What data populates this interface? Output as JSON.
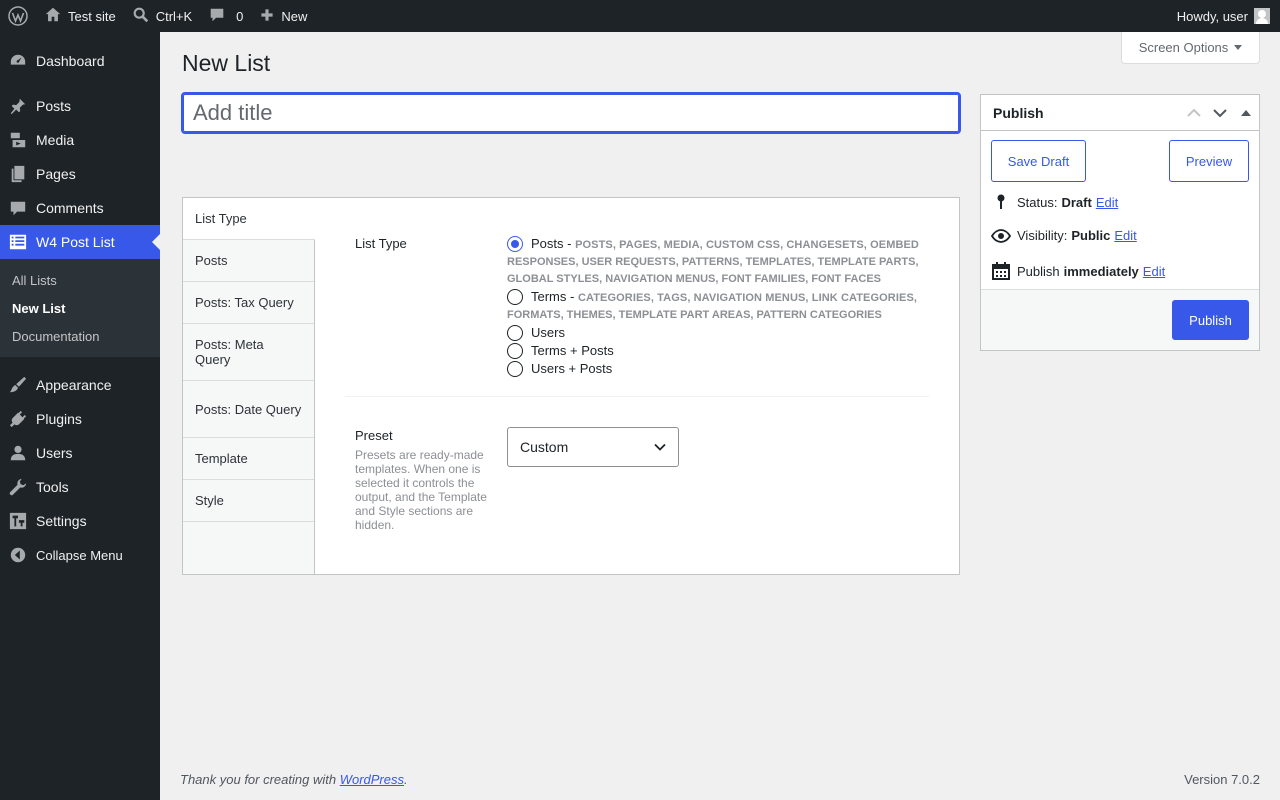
{
  "admin_bar": {
    "site_name": "Test site",
    "search_shortcut": "Ctrl+K",
    "comments_count": "0",
    "new_label": "New",
    "greeting": "Howdy, user"
  },
  "sidebar": {
    "items": [
      {
        "label": "Dashboard",
        "icon": "dashboard-icon"
      },
      {
        "label": "Posts",
        "icon": "pin-icon"
      },
      {
        "label": "Media",
        "icon": "media-icon"
      },
      {
        "label": "Pages",
        "icon": "pages-icon"
      },
      {
        "label": "Comments",
        "icon": "comment-icon"
      },
      {
        "label": "W4 Post List",
        "icon": "list-icon"
      },
      {
        "label": "Appearance",
        "icon": "brush-icon"
      },
      {
        "label": "Plugins",
        "icon": "plug-icon"
      },
      {
        "label": "Users",
        "icon": "user-icon"
      },
      {
        "label": "Tools",
        "icon": "wrench-icon"
      },
      {
        "label": "Settings",
        "icon": "settings-icon"
      },
      {
        "label": "Collapse Menu",
        "icon": "collapse-icon"
      }
    ],
    "submenu": [
      {
        "label": "All Lists"
      },
      {
        "label": "New List"
      },
      {
        "label": "Documentation"
      }
    ]
  },
  "screen_options": "Screen Options",
  "page_title": "New List",
  "title_placeholder": "Add title",
  "tabs": [
    "List Type",
    "Posts",
    "Posts: Tax Query",
    "Posts: Meta Query",
    "Posts: Date Query",
    "Template",
    "Style"
  ],
  "list_type": {
    "label": "List Type",
    "options": [
      {
        "label": "Posts",
        "hint_first": "POSTS, PAGES, MEDIA, CUSTOM CSS, CHANGESETS, OEMBED",
        "hint_rest": [
          "RESPONSES, USER REQUESTS, PATTERNS, TEMPLATES, TEMPLATE PARTS,",
          "GLOBAL STYLES, NAVIGATION MENUS, FONT FAMILIES, FONT FACES"
        ],
        "checked": true
      },
      {
        "label": "Terms",
        "hint_first": "CATEGORIES, TAGS, NAVIGATION MENUS, LINK CATEGORIES,",
        "hint_rest": [
          "FORMATS, THEMES, TEMPLATE PART AREAS, PATTERN CATEGORIES"
        ],
        "checked": false
      },
      {
        "label": "Users",
        "checked": false
      },
      {
        "label": "Terms + Posts",
        "checked": false
      },
      {
        "label": "Users + Posts",
        "checked": false
      }
    ]
  },
  "preset": {
    "label": "Preset",
    "description": "Presets are ready-made templates. When one is selected it controls the output, and the Template and Style sections are hidden.",
    "value": "Custom"
  },
  "publish": {
    "title": "Publish",
    "save_draft": "Save Draft",
    "preview": "Preview",
    "status_label": "Status:",
    "status_value": "Draft",
    "visibility_label": "Visibility:",
    "visibility_value": "Public",
    "publish_label": "Publish",
    "publish_value": "immediately",
    "edit": "Edit",
    "publish_button": "Publish"
  },
  "footer": {
    "thanks_prefix": "Thank you for creating with ",
    "wordpress_link": "WordPress",
    "thanks_suffix": ".",
    "version": "Version 7.0.2"
  },
  "colors": {
    "accent": "#3858e9",
    "admin_dark": "#1d2327",
    "background": "#f0f0f1"
  }
}
